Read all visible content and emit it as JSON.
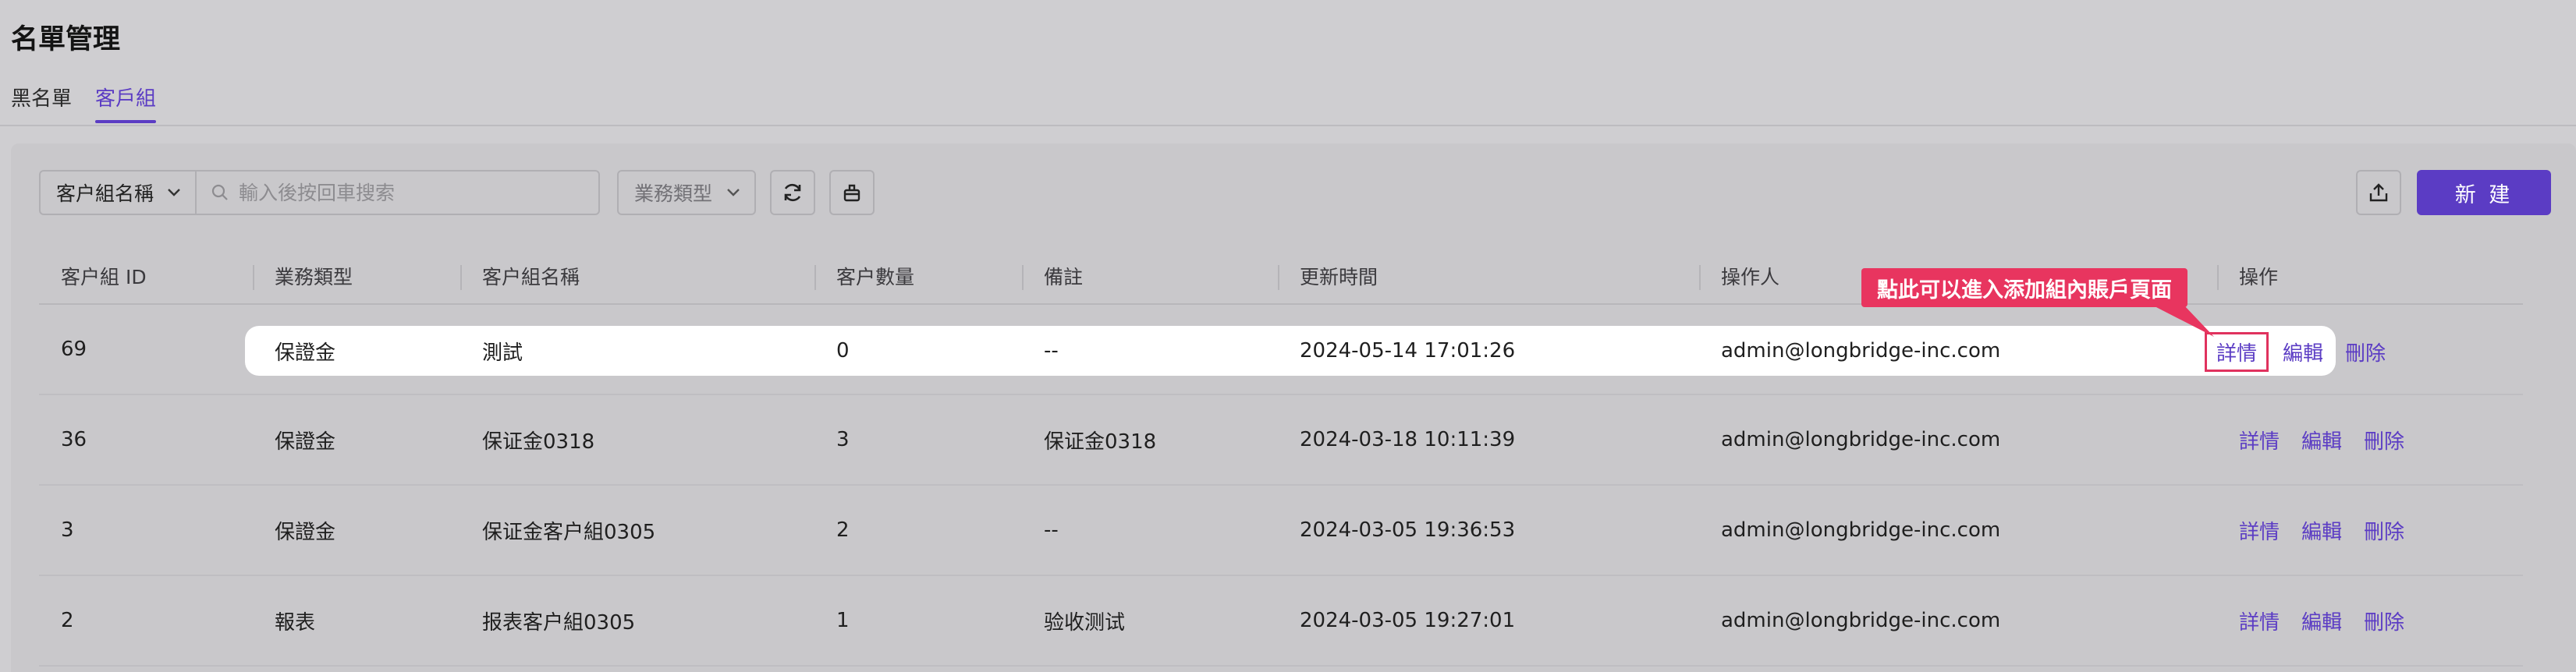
{
  "page": {
    "title": "名單管理"
  },
  "tabs": [
    {
      "label": "黑名單",
      "active": false
    },
    {
      "label": "客戶組",
      "active": true
    }
  ],
  "toolbar": {
    "search_type": "客户組名稱",
    "search_placeholder": "輸入後按回車搜索",
    "biz_type_placeholder": "業務類型",
    "new_label": "新 建"
  },
  "table": {
    "headers": [
      "客户組 ID",
      "業務類型",
      "客户組名稱",
      "客户數量",
      "備註",
      "更新時間",
      "操作人",
      "操作"
    ],
    "rows": [
      {
        "id": "69",
        "biz": "保證金",
        "name": "測試",
        "count": "0",
        "note": "--",
        "updated": "2024-05-14 17:01:26",
        "operator": "admin@longbridge-inc.com"
      },
      {
        "id": "36",
        "biz": "保證金",
        "name": "保证金0318",
        "count": "3",
        "note": "保证金0318",
        "updated": "2024-03-18 10:11:39",
        "operator": "admin@longbridge-inc.com"
      },
      {
        "id": "3",
        "biz": "保證金",
        "name": "保证金客户組0305",
        "count": "2",
        "note": "--",
        "updated": "2024-03-05 19:36:53",
        "operator": "admin@longbridge-inc.com"
      },
      {
        "id": "2",
        "biz": "報表",
        "name": "报表客户組0305",
        "count": "1",
        "note": "验收测试",
        "updated": "2024-03-05 19:27:01",
        "operator": "admin@longbridge-inc.com"
      }
    ],
    "actions": {
      "detail": "詳情",
      "edit": "編輯",
      "delete": "刪除"
    }
  },
  "callout": {
    "text": "點此可以進入添加組內賬戶頁面"
  },
  "colors": {
    "accent": "#5b3cc4",
    "callout": "#e8355f"
  }
}
